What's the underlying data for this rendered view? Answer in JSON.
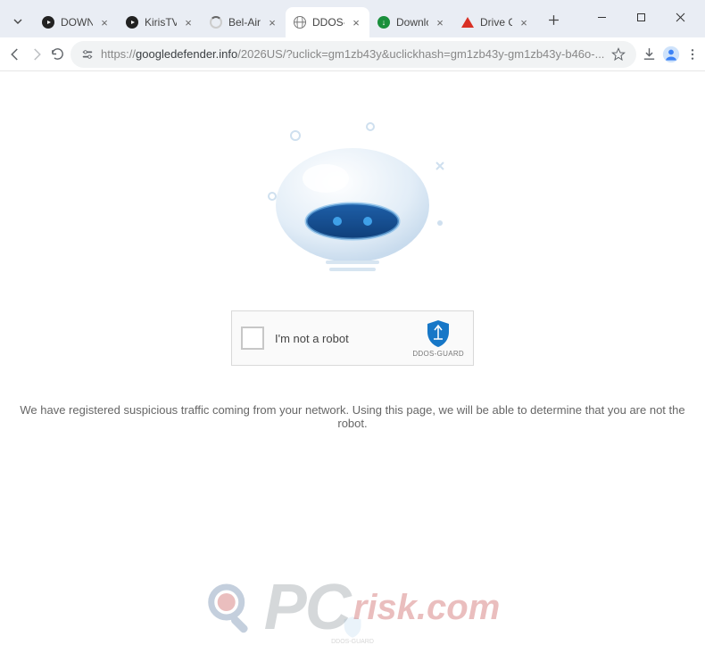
{
  "browser": {
    "tabs": [
      {
        "title": "DOWNL",
        "icon": "youtube"
      },
      {
        "title": "KirisTV F",
        "icon": "youtube"
      },
      {
        "title": "Bel-Air S",
        "icon": "spinner"
      },
      {
        "title": "DDOS-G",
        "icon": "globe",
        "active": true
      },
      {
        "title": "Downlo",
        "icon": "download"
      },
      {
        "title": "Drive Cl",
        "icon": "warning"
      }
    ],
    "url_prefix": "https://",
    "url_host": "googledefender.info",
    "url_path": "/2026US/?uclick=gm1zb43y&uclickhash=gm1zb43y-gm1zb43y-b46o-..."
  },
  "captcha": {
    "label": "I'm not a robot",
    "brand": "DDOS-GUARD"
  },
  "message": "We have registered suspicious traffic coming from your network. Using this page, we will be able to determine that you are not the robot.",
  "watermark": {
    "pc": "PC",
    "risk": "risk.com"
  }
}
